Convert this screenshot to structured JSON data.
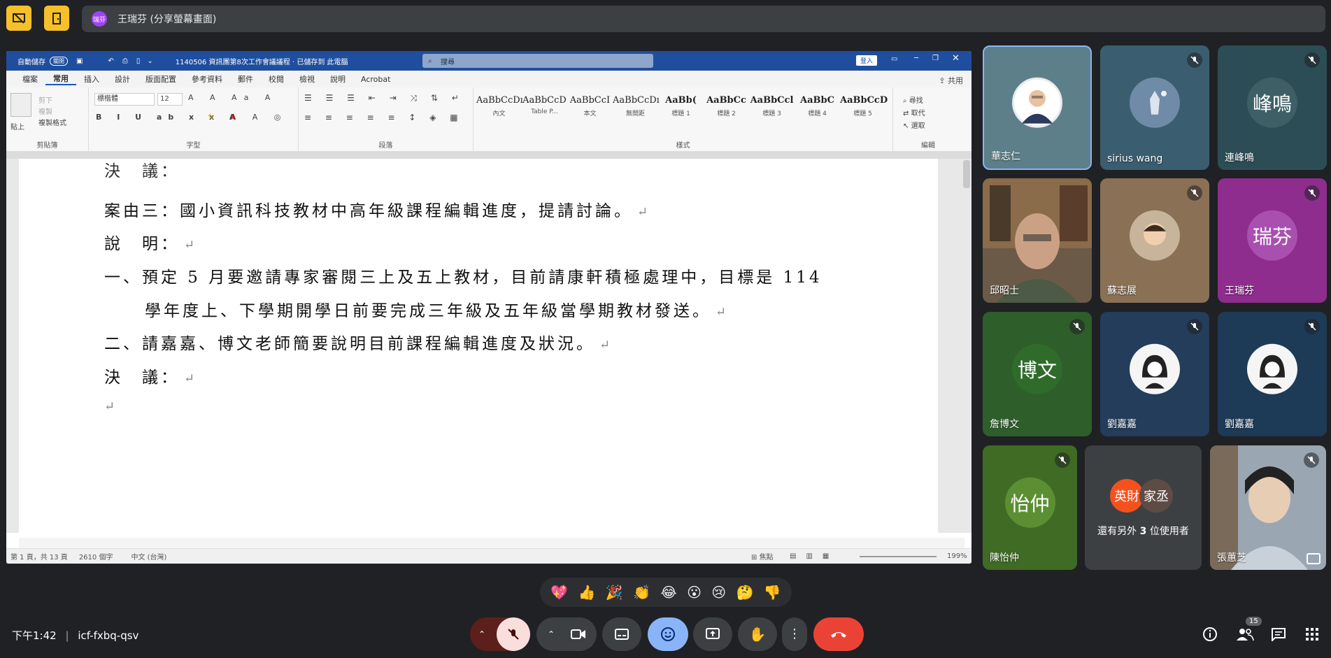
{
  "presenter": {
    "avatar_text": "瑞芬",
    "label": "王瑞芬 (分享螢幕畫面)"
  },
  "word": {
    "autosave_label": "自動儲存",
    "autosave_state": "關閉",
    "doc_title": "1140506 資訊團第8次工作會議議程 · 已儲存到 此電腦",
    "search_placeholder": "搜尋",
    "signin_label": "登入",
    "share_label": "共用",
    "tabs": [
      "檔案",
      "常用",
      "插入",
      "設計",
      "版面配置",
      "參考資料",
      "郵件",
      "校閱",
      "檢視",
      "說明",
      "Acrobat"
    ],
    "ribbon": {
      "paste_label": "貼上",
      "cut_label": "剪下",
      "copy_label": "複製",
      "format_painter_label": "複製格式",
      "font_name": "標楷體",
      "font_size": "12",
      "group_clipboard": "剪貼簿",
      "group_font": "字型",
      "group_paragraph": "段落",
      "group_styles": "樣式",
      "group_edit": "編輯",
      "find_label": "尋找",
      "replace_label": "取代",
      "select_label": "選取",
      "styles": [
        {
          "sample": "AaBbCcDı",
          "name": "內文"
        },
        {
          "sample": "AaBbCcD",
          "name": "Table P..."
        },
        {
          "sample": "AaBbCcI",
          "name": "本文"
        },
        {
          "sample": "AaBbCcDı",
          "name": "無間距"
        },
        {
          "sample": "AaBb(",
          "name": "標題 1"
        },
        {
          "sample": "AaBbCc",
          "name": "標題 2"
        },
        {
          "sample": "AaBbCcl",
          "name": "標題 3"
        },
        {
          "sample": "AaBbC",
          "name": "標題 4"
        },
        {
          "sample": "AaBbCcD",
          "name": "標題 5"
        }
      ]
    },
    "lines": {
      "l0": "決　議：",
      "l1": "案由三：國小資訊科技教材中高年級課程編輯進度，提請討論。",
      "l2": "說　明：",
      "l3": "一、預定 5 月要邀請專家審閱三上及五上教材，目前請康軒積極處理中，目標是 114",
      "l4": "學年度上、下學期開學日前要完成三年級及五年級當學期教材發送。",
      "l5": "二、請嘉嘉、博文老師簡要說明目前課程編輯進度及狀況。",
      "l6": "決　議："
    },
    "status": {
      "page": "第 1 頁，共 13 頁",
      "words": "2610 個字",
      "lang": "中文 (台灣)",
      "focus": "焦點",
      "zoom": "199%"
    }
  },
  "participants": [
    {
      "name": "華志仁",
      "muted": false,
      "active": true
    },
    {
      "name": "sirius wang",
      "muted": true
    },
    {
      "name": "連峰鳴",
      "initials": "峰鳴",
      "muted": true
    },
    {
      "name": "邱昭士",
      "muted": true
    },
    {
      "name": "蘇志展",
      "muted": true
    },
    {
      "name": "王瑞芬",
      "initials": "瑞芬",
      "muted": true
    },
    {
      "name": "詹博文",
      "initials": "博文",
      "muted": true
    },
    {
      "name": "劉嘉嘉",
      "muted": true
    },
    {
      "name": "劉嘉嘉",
      "muted": true
    },
    {
      "name": "陳怡仲",
      "initials": "怡仲",
      "muted": true
    },
    {
      "name": "張蕙芝",
      "muted": true
    }
  ],
  "others": {
    "avatar1": "英財",
    "avatar2": "家丞",
    "label_pre": "還有另外 ",
    "count": "3",
    "label_post": " 位使用者"
  },
  "reactions": [
    "💖",
    "👍",
    "🎉",
    "👏",
    "😂",
    "😮",
    "😢",
    "🤔",
    "👎"
  ],
  "bottom": {
    "time": "下午1:42",
    "meeting_code": "icf-fxbq-qsv",
    "people_count": "15"
  },
  "colors": {
    "accent_blue": "#8ab4f8",
    "end_call": "#ea4335",
    "word_blue": "#1f4e9e",
    "tile_highlight": "#8ab4f8"
  }
}
